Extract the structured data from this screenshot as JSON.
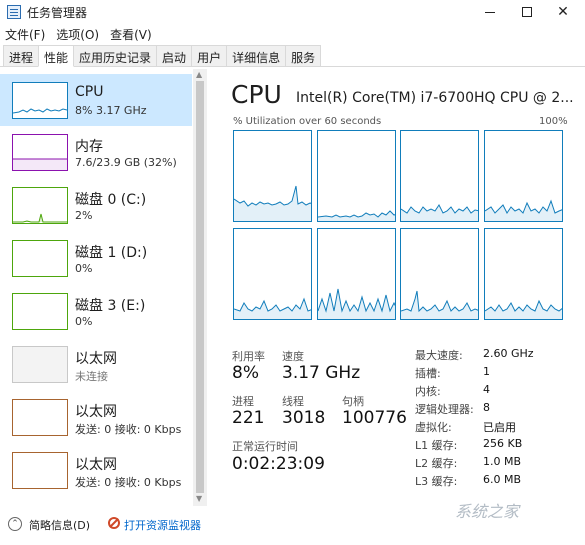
{
  "window": {
    "title": "任务管理器"
  },
  "menu": [
    "文件(F)",
    "选项(O)",
    "查看(V)"
  ],
  "tabs": [
    "进程",
    "性能",
    "应用历史记录",
    "启动",
    "用户",
    "详细信息",
    "服务"
  ],
  "active_tab": "性能",
  "sidebar": [
    {
      "name": "CPU",
      "sub": "8% 3.17 GHz",
      "color": "#117dbb"
    },
    {
      "name": "内存",
      "sub": "7.6/23.9 GB (32%)",
      "color": "#8b12ae"
    },
    {
      "name": "磁盘 0 (C:)",
      "sub": "2%",
      "color": "#4da60c"
    },
    {
      "name": "磁盘 1 (D:)",
      "sub": "0%",
      "color": "#4da60c"
    },
    {
      "name": "磁盘 3 (E:)",
      "sub": "0%",
      "color": "#4da60c"
    },
    {
      "name": "以太网",
      "sub": "未连接",
      "color": "#c8c8c8"
    },
    {
      "name": "以太网",
      "sub": "发送: 0 接收: 0 Kbps",
      "color": "#a7642f"
    },
    {
      "name": "以太网",
      "sub": "发送: 0 接收: 0 Kbps",
      "color": "#a7642f"
    }
  ],
  "main": {
    "title": "CPU",
    "model": "Intel(R) Core(TM) i7-6700HQ CPU @ 2...",
    "graph_caption_left": "% Utilization over 60 seconds",
    "graph_caption_right": "100%",
    "stats": {
      "utilization_label": "利用率",
      "utilization_value": "8%",
      "speed_label": "速度",
      "speed_value": "3.17 GHz",
      "processes_label": "进程",
      "processes_value": "221",
      "threads_label": "线程",
      "threads_value": "3018",
      "handles_label": "句柄",
      "handles_value": "100776",
      "uptime_label": "正常运行时间",
      "uptime_value": "0:02:23:09"
    },
    "specs": [
      {
        "label": "最大速度:",
        "value": "2.60 GHz"
      },
      {
        "label": "插槽:",
        "value": "1"
      },
      {
        "label": "内核:",
        "value": "4"
      },
      {
        "label": "逻辑处理器:",
        "value": "8"
      },
      {
        "label": "虚拟化:",
        "value": "已启用"
      },
      {
        "label": "L1 缓存:",
        "value": "256 KB"
      },
      {
        "label": "L2 缓存:",
        "value": "1.0 MB"
      },
      {
        "label": "L3 缓存:",
        "value": "6.0 MB"
      }
    ]
  },
  "footer": {
    "brief": "简略信息(D)",
    "monitor": "打开资源监视器"
  },
  "watermark": "系统之家"
}
